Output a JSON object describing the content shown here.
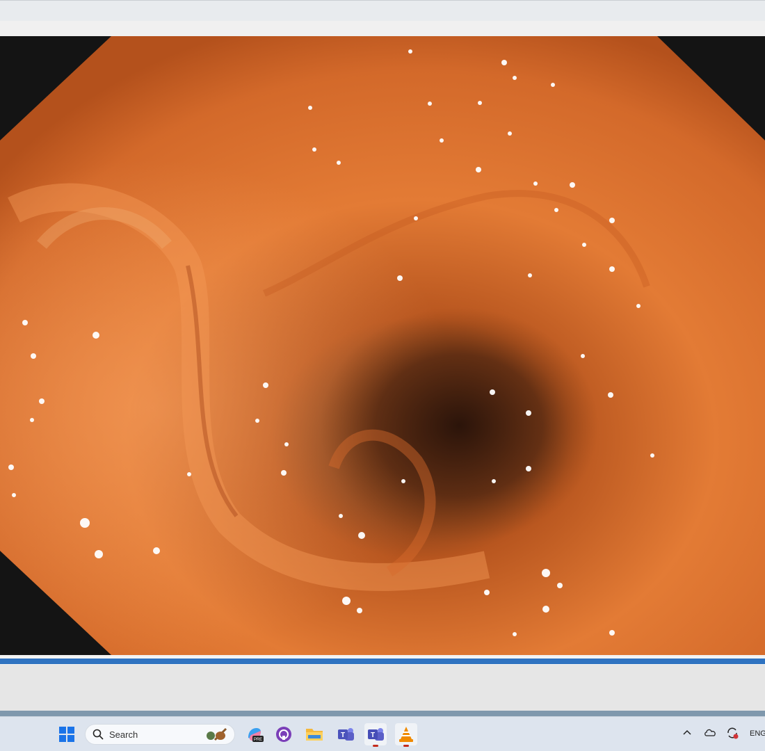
{
  "taskbar": {
    "search_label": "Search",
    "language": "ENG",
    "apps": [
      {
        "name": "copilot-icon",
        "label": "PRE"
      },
      {
        "name": "github-desktop-icon"
      },
      {
        "name": "file-explorer-icon"
      },
      {
        "name": "teams-classic-icon",
        "label": "T"
      },
      {
        "name": "teams-icon",
        "label": "T"
      },
      {
        "name": "vlc-icon"
      }
    ]
  },
  "colors": {
    "seek_accent": "#2f73c1",
    "mucosa": "#e07a34"
  }
}
